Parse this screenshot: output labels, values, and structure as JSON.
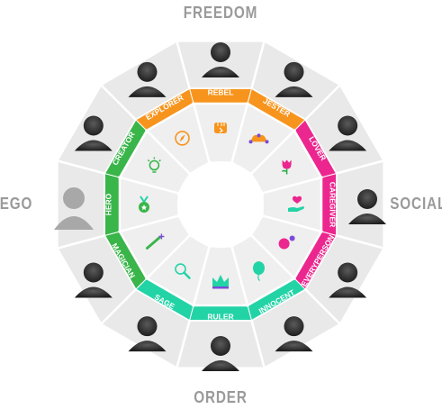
{
  "axes": {
    "top": "FREEDOM",
    "bottom": "ORDER",
    "left": "EGO",
    "right": "SOCIAL"
  },
  "archetypes": [
    {
      "label": "REBEL",
      "color": "#f7941d",
      "icon": "fist-icon"
    },
    {
      "label": "JESTER",
      "color": "#f7941d",
      "icon": "jester-hat-icon"
    },
    {
      "label": "LOVER",
      "color": "#ec268f",
      "icon": "rose-icon"
    },
    {
      "label": "CAREGIVER",
      "color": "#ec268f",
      "icon": "heart-hand-icon"
    },
    {
      "label": "EVERYPERSON",
      "color": "#ec268f",
      "icon": "balls-icon"
    },
    {
      "label": "INNOCENT",
      "color": "#22d3a6",
      "icon": "balloon-icon"
    },
    {
      "label": "RULER",
      "color": "#22d3a6",
      "icon": "crown-icon"
    },
    {
      "label": "SAGE",
      "color": "#22d3a6",
      "icon": "magnifier-icon"
    },
    {
      "label": "MAGICIAN",
      "color": "#39b54a",
      "icon": "wand-icon"
    },
    {
      "label": "HERO",
      "color": "#39b54a",
      "icon": "medal-icon"
    },
    {
      "label": "CREATOR",
      "color": "#39b54a",
      "icon": "lightbulb-icon"
    },
    {
      "label": "EXPLORER",
      "color": "#f7941d",
      "icon": "compass-icon"
    }
  ]
}
